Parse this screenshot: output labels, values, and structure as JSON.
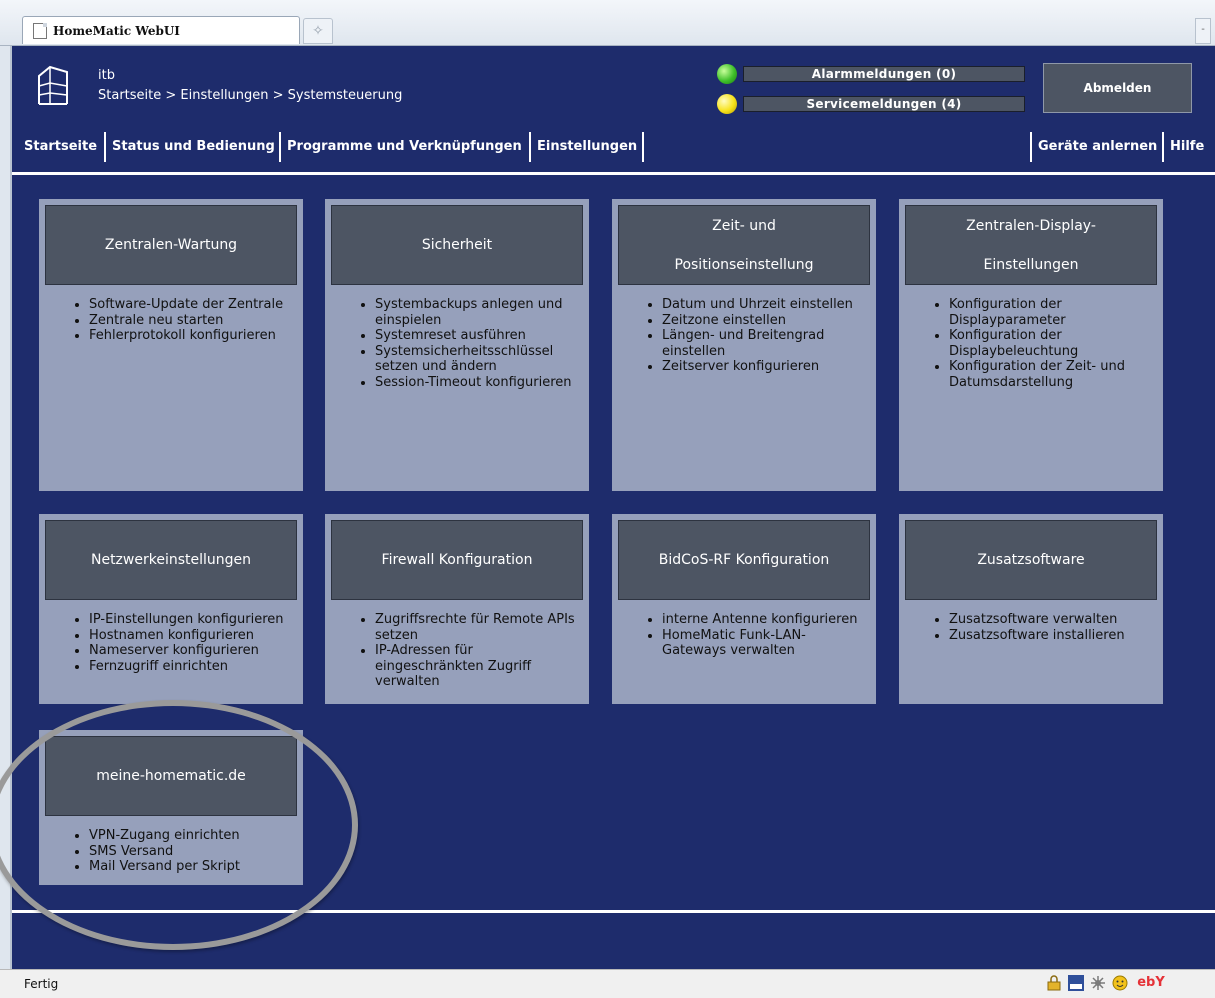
{
  "browser": {
    "tab_title": "HomeMatic WebUI",
    "new_tab_symbol": "✧",
    "scroll_symbol": "-"
  },
  "header": {
    "user": "itb",
    "breadcrumb": "Startseite > Einstellungen > Systemsteuerung",
    "alarm_messages": "Alarmmeldungen (0)",
    "service_messages": "Servicemeldungen (4)",
    "logout": "Abmelden"
  },
  "nav": {
    "home": "Startseite",
    "status": "Status und Bedienung",
    "programs": "Programme und Verknüpfungen",
    "settings": "Einstellungen",
    "teach_devices": "Geräte anlernen",
    "help": "Hilfe"
  },
  "tiles": [
    {
      "title": [
        "Zentralen-Wartung"
      ],
      "items": [
        "Software-Update der Zentrale",
        "Zentrale neu starten",
        "Fehlerprotokoll konfigurieren"
      ]
    },
    {
      "title": [
        "Sicherheit"
      ],
      "items": [
        "Systembackups anlegen und einspielen",
        "Systemreset ausführen",
        "Systemsicherheitsschlüssel setzen und ändern",
        "Session-Timeout konfigurieren"
      ]
    },
    {
      "title": [
        "Zeit- und",
        "Positionseinstellung"
      ],
      "items": [
        "Datum und Uhrzeit einstellen",
        "Zeitzone einstellen",
        "Längen- und Breitengrad einstellen",
        "Zeitserver konfigurieren"
      ]
    },
    {
      "title": [
        "Zentralen-Display-",
        "Einstellungen"
      ],
      "items": [
        "Konfiguration der Displayparameter",
        "Konfiguration der Displaybeleuchtung",
        "Konfiguration der Zeit- und Datumsdarstellung"
      ]
    },
    {
      "title": [
        "Netzwerkeinstellungen"
      ],
      "items": [
        "IP-Einstellungen konfigurieren",
        "Hostnamen konfigurieren",
        "Nameserver konfigurieren",
        "Fernzugriff einrichten"
      ]
    },
    {
      "title": [
        "Firewall Konfiguration"
      ],
      "items": [
        "Zugriffsrechte für Remote APIs setzen",
        "IP-Adressen für eingeschränkten Zugriff verwalten"
      ]
    },
    {
      "title": [
        "BidCoS-RF Konfiguration"
      ],
      "items": [
        "interne Antenne konfigurieren",
        "HomeMatic Funk-LAN-Gateways verwalten"
      ]
    },
    {
      "title": [
        "Zusatzsoftware"
      ],
      "items": [
        "Zusatzsoftware verwalten",
        "Zusatzsoftware installieren"
      ]
    },
    {
      "title": [
        "meine-homematic.de"
      ],
      "items": [
        "VPN-Zugang einrichten",
        "SMS Versand",
        "Mail Versand per Skript"
      ]
    }
  ],
  "statusbar": {
    "text": "Fertig",
    "icons": [
      "lock-icon",
      "rss-icon",
      "addon-icon",
      "smiley-icon",
      "ebay-icon"
    ],
    "ebay_label": "ebY"
  },
  "colors": {
    "page_bg": "#1e2c6c",
    "tile_bg": "#96a0bb",
    "tile_head": "#4d5563",
    "led_alarm": "#3fc02a",
    "led_service": "#f7e21a"
  }
}
